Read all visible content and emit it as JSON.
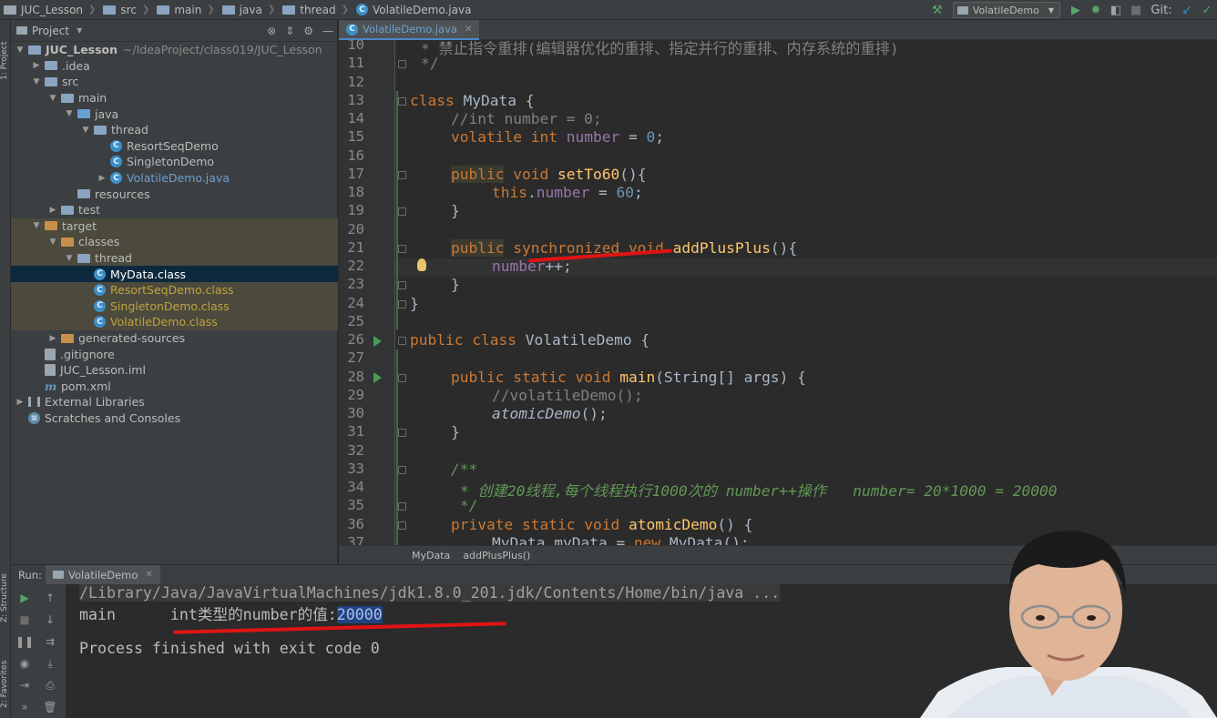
{
  "breadcrumb": [
    "JUC_Lesson",
    "src",
    "main",
    "java",
    "thread",
    "VolatileDemo.java"
  ],
  "toolbar": {
    "run_config": "VolatileDemo",
    "git_label": "Git:"
  },
  "side_labels": {
    "project": "1: Project",
    "structure": "Z: Structure",
    "favorites": "2: Favorites"
  },
  "project_panel": {
    "title": "Project",
    "tree": [
      {
        "label": "JUC_Lesson",
        "hint": "~/IdeaProject/class019/JUC_Lesson",
        "depth": 0,
        "open": true,
        "icon": "folder"
      },
      {
        "label": ".idea",
        "depth": 1,
        "open": false,
        "icon": "folder"
      },
      {
        "label": "src",
        "depth": 1,
        "open": true,
        "icon": "folder"
      },
      {
        "label": "main",
        "depth": 2,
        "open": true,
        "icon": "folder"
      },
      {
        "label": "java",
        "depth": 3,
        "open": true,
        "icon": "folder-blue"
      },
      {
        "label": "thread",
        "depth": 4,
        "open": true,
        "icon": "folder"
      },
      {
        "label": "ResortSeqDemo",
        "depth": 5,
        "icon": "class"
      },
      {
        "label": "SingletonDemo",
        "depth": 5,
        "icon": "class"
      },
      {
        "label": "VolatileDemo.java",
        "depth": 5,
        "open": false,
        "icon": "class"
      },
      {
        "label": "resources",
        "depth": 3,
        "icon": "folder"
      },
      {
        "label": "test",
        "depth": 2,
        "open": false,
        "icon": "folder"
      },
      {
        "label": "target",
        "depth": 1,
        "open": true,
        "icon": "folder-orange"
      },
      {
        "label": "classes",
        "depth": 2,
        "open": true,
        "icon": "folder-orange"
      },
      {
        "label": "thread",
        "depth": 3,
        "open": true,
        "icon": "folder"
      },
      {
        "label": "MyData.class",
        "depth": 4,
        "icon": "class"
      },
      {
        "label": "ResortSeqDemo.class",
        "depth": 4,
        "icon": "class"
      },
      {
        "label": "SingletonDemo.class",
        "depth": 4,
        "icon": "class"
      },
      {
        "label": "VolatileDemo.class",
        "depth": 4,
        "icon": "class"
      },
      {
        "label": "generated-sources",
        "depth": 2,
        "open": false,
        "icon": "folder-orange"
      },
      {
        "label": ".gitignore",
        "depth": 1,
        "icon": "file"
      },
      {
        "label": "JUC_Lesson.iml",
        "depth": 1,
        "icon": "file"
      },
      {
        "label": "pom.xml",
        "depth": 1,
        "icon": "maven"
      },
      {
        "label": "External Libraries",
        "depth": 0,
        "open": false,
        "icon": "lib"
      },
      {
        "label": "Scratches and Consoles",
        "depth": 0,
        "icon": "scratch"
      }
    ]
  },
  "editor": {
    "tab": "VolatileDemo.java",
    "lines": [
      {
        "n": "10",
        "text": "* 禁止指令重排(编辑器优化的重排、指定并行的重排、内存系统的重排)"
      },
      {
        "n": "11",
        "text": "*/"
      },
      {
        "n": "12",
        "text": ""
      },
      {
        "n": "13",
        "text": "class MyData {"
      },
      {
        "n": "14",
        "text": "//int number = 0;"
      },
      {
        "n": "15",
        "text": "volatile int number = 0;"
      },
      {
        "n": "16",
        "text": ""
      },
      {
        "n": "17",
        "text": "public void setTo60(){"
      },
      {
        "n": "18",
        "text": "this.number = 60;"
      },
      {
        "n": "19",
        "text": "}"
      },
      {
        "n": "20",
        "text": ""
      },
      {
        "n": "21",
        "text": "public synchronized void addPlusPlus(){"
      },
      {
        "n": "22",
        "text": "number++;"
      },
      {
        "n": "23",
        "text": "}"
      },
      {
        "n": "24",
        "text": "}"
      },
      {
        "n": "25",
        "text": ""
      },
      {
        "n": "26",
        "text": "public class VolatileDemo {"
      },
      {
        "n": "27",
        "text": ""
      },
      {
        "n": "28",
        "text": "public static void main(String[] args) {"
      },
      {
        "n": "29",
        "text": "//volatileDemo();"
      },
      {
        "n": "30",
        "text": "atomicDemo();"
      },
      {
        "n": "31",
        "text": "}"
      },
      {
        "n": "32",
        "text": ""
      },
      {
        "n": "33",
        "text": "/**"
      },
      {
        "n": "34",
        "text": "* 创建20线程,每个线程执行1000次的 number++操作   number= 20*1000 = 20000"
      },
      {
        "n": "35",
        "text": "*/"
      },
      {
        "n": "36",
        "text": "private static void atomicDemo() {"
      },
      {
        "n": "37",
        "text": "MyData myData = new MyData();"
      }
    ],
    "breadcrumb": [
      "MyData",
      "addPlusPlus()"
    ]
  },
  "run_panel": {
    "label": "Run:",
    "tab": "VolatileDemo",
    "console": {
      "cmd": "/Library/Java/JavaVirtualMachines/jdk1.8.0_201.jdk/Contents/Home/bin/java ...",
      "thread": "main",
      "msg_prefix": "int类型的number的值:",
      "msg_value": "20000",
      "exit": "Process finished with exit code 0"
    }
  },
  "colors": {
    "keyword": "#cc7832",
    "number": "#6897bb",
    "field": "#9876aa",
    "method": "#ffc66d",
    "comment": "#808080",
    "doc_comment": "#629755",
    "annotation_red": "#e01414"
  }
}
